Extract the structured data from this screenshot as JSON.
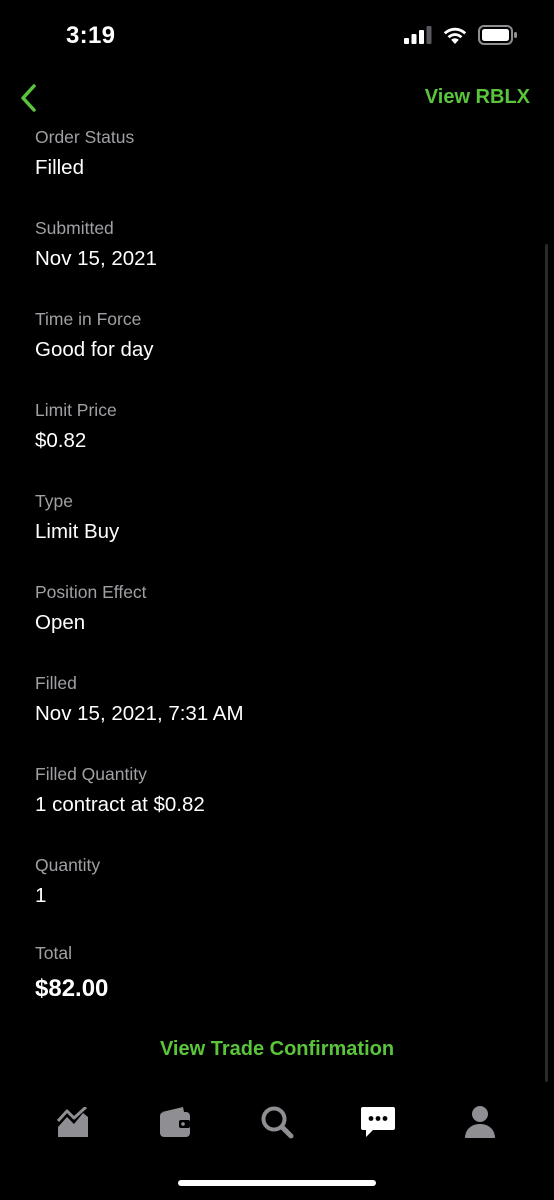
{
  "status_bar": {
    "time": "3:19"
  },
  "nav": {
    "view_link": "View RBLX"
  },
  "details": [
    {
      "label": "Order Status",
      "value": "Filled"
    },
    {
      "label": "Submitted",
      "value": "Nov 15, 2021"
    },
    {
      "label": "Time in Force",
      "value": "Good for day"
    },
    {
      "label": "Limit Price",
      "value": "$0.82"
    },
    {
      "label": "Type",
      "value": "Limit Buy"
    },
    {
      "label": "Position Effect",
      "value": "Open"
    },
    {
      "label": "Filled",
      "value": "Nov 15, 2021, 7:31 AM"
    },
    {
      "label": "Filled Quantity",
      "value": "1 contract at $0.82"
    },
    {
      "label": "Quantity",
      "value": "1"
    }
  ],
  "total": {
    "label": "Total",
    "value": "$82.00"
  },
  "confirm_link": "View Trade Confirmation",
  "tabs": [
    {
      "icon": "chart-icon",
      "selected": false
    },
    {
      "icon": "wallet-icon",
      "selected": false
    },
    {
      "icon": "search-icon",
      "selected": false
    },
    {
      "icon": "messages-icon",
      "selected": true
    },
    {
      "icon": "account-icon",
      "selected": false
    }
  ],
  "colors": {
    "accent": "#5ac53b",
    "background": "#000000",
    "label": "#a0a0a5",
    "tab_inactive": "#8e8e93",
    "tab_active": "#ffffff"
  }
}
